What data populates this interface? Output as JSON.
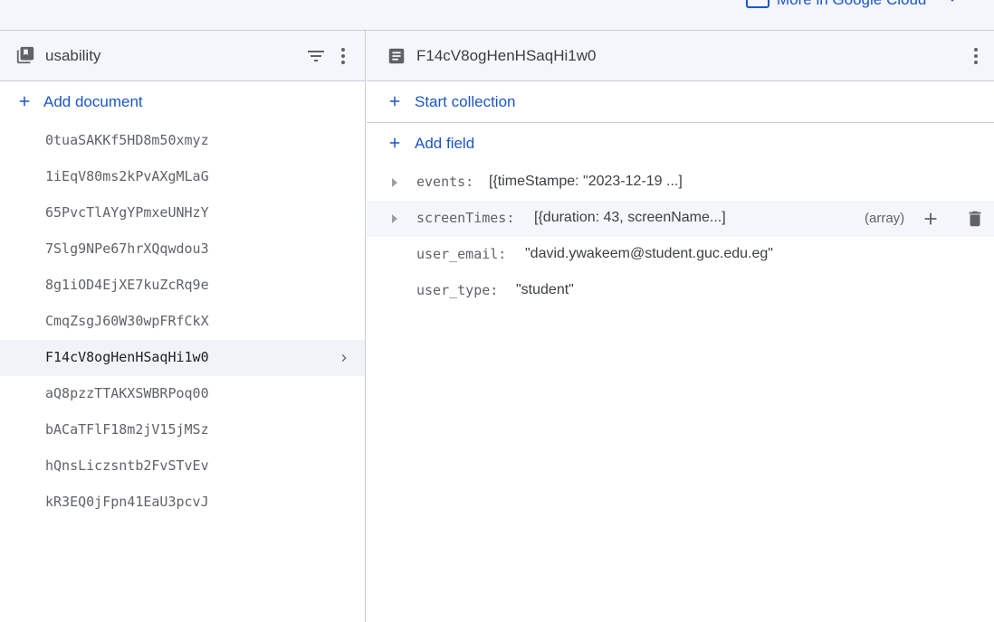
{
  "topbar": {
    "cloud_link": "More in Google Cloud"
  },
  "collection_panel": {
    "title": "usability",
    "add_label": "Add document",
    "documents": [
      {
        "id": "0tuaSAKKf5HD8m50xmyz"
      },
      {
        "id": "1iEqV80ms2kPvAXgMLaG"
      },
      {
        "id": "65PvcTlAYgYPmxeUNHzY"
      },
      {
        "id": "7Slg9NPe67hrXQqwdou3"
      },
      {
        "id": "8g1iOD4EjXE7kuZcRq9e"
      },
      {
        "id": "CmqZsgJ60W30wpFRfCkX"
      },
      {
        "id": "F14cV8ogHenHSaqHi1w0",
        "selected": true
      },
      {
        "id": "aQ8pzzTTAKXSWBRPoq00"
      },
      {
        "id": "bACaTFlF18m2jV15jMSz"
      },
      {
        "id": "hQnsLiczsntb2FvSTvEv"
      },
      {
        "id": "kR3EQ0jFpn41EaU3pcvJ"
      }
    ]
  },
  "document_panel": {
    "title": "F14cV8ogHenHSaqHi1w0",
    "start_collection_label": "Start collection",
    "add_field_label": "Add field",
    "fields": [
      {
        "key": "events:",
        "value": "[{timeStampe: \"2023-12-19 ...]",
        "expandable": true
      },
      {
        "key": "screenTimes:",
        "value": "[{duration: 43, screenName...]",
        "type": "(array)",
        "expandable": true,
        "hover": true
      },
      {
        "key": "user_email:",
        "value": "\"david.ywakeem@student.guc.edu.eg\""
      },
      {
        "key": "user_type:",
        "value": "\"student\""
      }
    ]
  },
  "colors": {
    "accent": "#1a56c8",
    "header_bg": "#f4f6fb",
    "border": "#c6ccd6",
    "selected_bg": "#f1f3f8",
    "icon_gray": "#5f6368"
  }
}
